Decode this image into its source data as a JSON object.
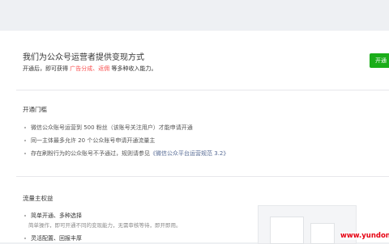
{
  "intro": {
    "title": "我们为公众号运营者提供变现方式",
    "desc_prefix": "开通后，即可获得",
    "highlight": "广告分成、返佣",
    "desc_suffix": "等多种收入能力。",
    "open_button": "开通"
  },
  "requirements": {
    "title": "开通门槛",
    "items": [
      {
        "text": "微信公众账号运营到 500 粉丝（该账号关注用户）才能申请开通",
        "link": ""
      },
      {
        "text": "同一主体最多允许 20 个公众账号申请开通流量主",
        "link": ""
      },
      {
        "text": "存在刷粉行为的公众账号不予通过，规则请参见",
        "link": "《微信公众平台运营规范 3.2》"
      }
    ]
  },
  "benefits": {
    "title": "流量主权益",
    "items": [
      {
        "title": "简单开通、多种选择",
        "desc": "简单操作，即可开通不同的变现能力，无需审核等待，即开即用。"
      },
      {
        "title": "灵活配置、回报丰厚",
        "desc": ""
      }
    ]
  },
  "watermark": "www.yundong"
}
